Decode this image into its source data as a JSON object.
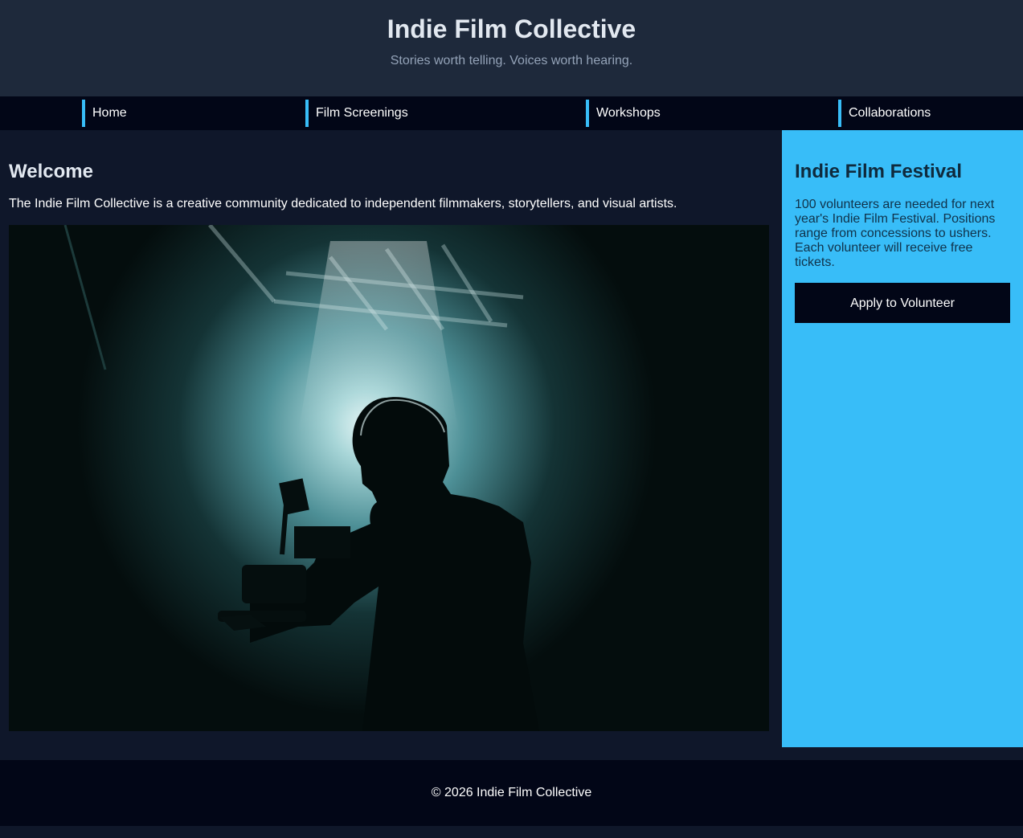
{
  "header": {
    "title": "Indie Film Collective",
    "tagline": "Stories worth telling. Voices worth hearing."
  },
  "nav": {
    "items": [
      {
        "label": "Home"
      },
      {
        "label": "Film Screenings"
      },
      {
        "label": "Workshops"
      },
      {
        "label": "Collaborations"
      }
    ]
  },
  "main": {
    "heading": "Welcome",
    "intro": "The Indie Film Collective is a creative community dedicated to independent filmmakers, storytellers, and visual artists."
  },
  "aside": {
    "heading": "Indie Film Festival",
    "body": "100 volunteers are needed for next year's Indie Film Festival. Positions range from concessions to ushers. Each volunteer will receive free tickets.",
    "cta_label": "Apply to Volunteer"
  },
  "footer": {
    "text": "© 2026 Indie Film Collective"
  },
  "colors": {
    "page_bg": "#0f172a",
    "header_bg": "#1e293b",
    "nav_bg": "#020617",
    "accent": "#38bdf8"
  }
}
